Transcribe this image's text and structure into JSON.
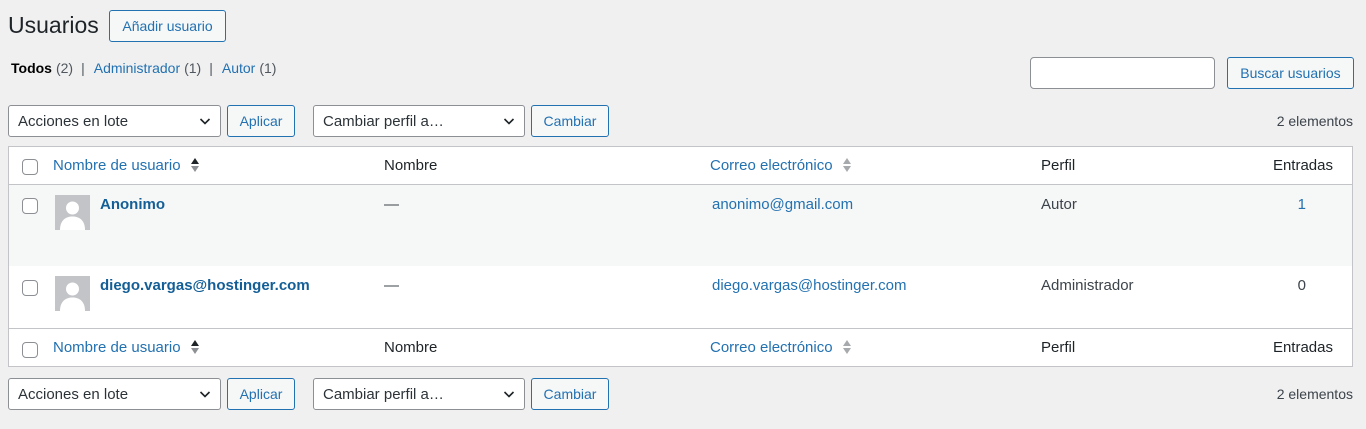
{
  "page": {
    "title": "Usuarios",
    "add_button": "Añadir usuario"
  },
  "filters": [
    {
      "label": "Todos",
      "count": "(2)",
      "current": true
    },
    {
      "label": "Administrador",
      "count": "(1)",
      "current": false
    },
    {
      "label": "Autor",
      "count": "(1)",
      "current": false
    }
  ],
  "filter_separator": "|",
  "search": {
    "value": "",
    "button": "Buscar usuarios"
  },
  "top_bar": {
    "bulk_select": "Acciones en lote",
    "apply_button": "Aplicar",
    "role_select": "Cambiar perfil a…",
    "change_button": "Cambiar",
    "count": "2 elementos"
  },
  "bottom_bar": {
    "bulk_select": "Acciones en lote",
    "apply_button": "Aplicar",
    "role_select": "Cambiar perfil a…",
    "change_button": "Cambiar",
    "count": "2 elementos"
  },
  "columns": {
    "username": "Nombre de usuario",
    "name": "Nombre",
    "email": "Correo electrónico",
    "role": "Perfil",
    "posts": "Entradas"
  },
  "users": [
    {
      "username": "Anonimo",
      "name": "—",
      "email": "anonimo@gmail.com",
      "role": "Autor",
      "posts": "1",
      "posts_is_link": true
    },
    {
      "username": "diego.vargas@hostinger.com",
      "name": "—",
      "email": "diego.vargas@hostinger.com",
      "role": "Administrador",
      "posts": "0",
      "posts_is_link": false
    }
  ],
  "colors": {
    "link": "#2271b1",
    "background": "#f0f0f1",
    "border": "#c3c4c7"
  }
}
